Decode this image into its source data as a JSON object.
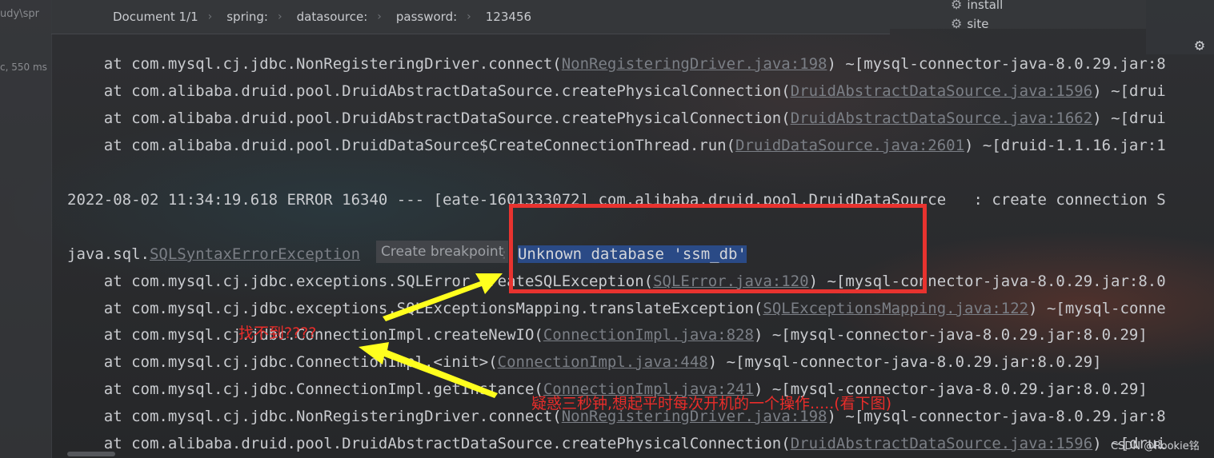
{
  "gutter": {
    "top_text": "udy\\spr",
    "timing": "c, 550 ms"
  },
  "breadcrumb": [
    {
      "label": "Document 1/1"
    },
    {
      "label": "spring:"
    },
    {
      "label": "datasource:"
    },
    {
      "label": "password:"
    },
    {
      "label": "123456"
    }
  ],
  "breadcrumb_separator": "›",
  "right_panel": {
    "items": [
      "install",
      "site"
    ],
    "icon": "gear-icon"
  },
  "console": {
    "lines": [
      {
        "prefix": "    at com.mysql.cj.jdbc.NonRegisteringDriver.connect(",
        "link": "NonRegisteringDriver.java:198",
        "suffix": ") ~[mysql-connector-java-8.0.29.jar:8"
      },
      {
        "prefix": "    at com.alibaba.druid.pool.DruidAbstractDataSource.createPhysicalConnection(",
        "link": "DruidAbstractDataSource.java:1596",
        "suffix": ") ~[drui"
      },
      {
        "prefix": "    at com.alibaba.druid.pool.DruidAbstractDataSource.createPhysicalConnection(",
        "link": "DruidAbstractDataSource.java:1662",
        "suffix": ") ~[drui"
      },
      {
        "prefix": "    at com.alibaba.druid.pool.DruidDataSource$CreateConnectionThread.run(",
        "link": "DruidDataSource.java:2601",
        "suffix": ") ~[druid-1.1.16.jar:1"
      },
      {
        "prefix": "",
        "link": "",
        "suffix": ""
      },
      {
        "prefix": "2022-08-02 11:34:19.618 ERROR 16340 --- [eate-1601333072] com.alibaba.druid.pool.DruidDataSource   : create connection S",
        "link": "",
        "suffix": ""
      },
      {
        "prefix": "",
        "link": "",
        "suffix": ""
      },
      {
        "prefix": "java.sql.",
        "link": "SQLSyntaxErrorException",
        "suffix": "",
        "selected": "Unknown database 'ssm_db'"
      },
      {
        "prefix": "    at com.mysql.cj.jdbc.exceptions.SQLError.createSQLException(",
        "link": "SQLError.java:120",
        "suffix": ") ~[mysql-connector-java-8.0.29.jar:8.0"
      },
      {
        "prefix": "    at com.mysql.cj.jdbc.exceptions.SQLExceptionsMapping.translateException(",
        "link": "SQLExceptionsMapping.java:122",
        "suffix": ") ~[mysql-conne"
      },
      {
        "prefix": "    at com.mysql.cj.jdbc.ConnectionImpl.createNewIO(",
        "link": "ConnectionImpl.java:828",
        "suffix": ") ~[mysql-connector-java-8.0.29.jar:8.0.29]"
      },
      {
        "prefix": "    at com.mysql.cj.jdbc.ConnectionImpl.<init>(",
        "link": "ConnectionImpl.java:448",
        "suffix": ") ~[mysql-connector-java-8.0.29.jar:8.0.29]"
      },
      {
        "prefix": "    at com.mysql.cj.jdbc.ConnectionImpl.getInstance(",
        "link": "ConnectionImpl.java:241",
        "suffix": ") ~[mysql-connector-java-8.0.29.jar:8.0.29]"
      },
      {
        "prefix": "    at com.mysql.cj.jdbc.NonRegisteringDriver.connect(",
        "link": "NonRegisteringDriver.java:198",
        "suffix": ") ~[mysql-connector-java-8.0.29.jar:8"
      },
      {
        "prefix": "    at com.alibaba.druid.pool.DruidAbstractDataSource.createPhysicalConnection(",
        "link": "DruidAbstractDataSource.java:1596",
        "suffix": ") ~[drui"
      }
    ]
  },
  "tooltip": {
    "text": "Create breakpoint"
  },
  "annotations": {
    "cannot_find": "找不到????",
    "puzzled": "疑惑三秒钟,想起平时每次开机的一个操作.....(看下图)",
    "arrow_color": "#ffff1e",
    "box_color": "#e8332f"
  },
  "watermark": "CSDN @Rookie铭"
}
